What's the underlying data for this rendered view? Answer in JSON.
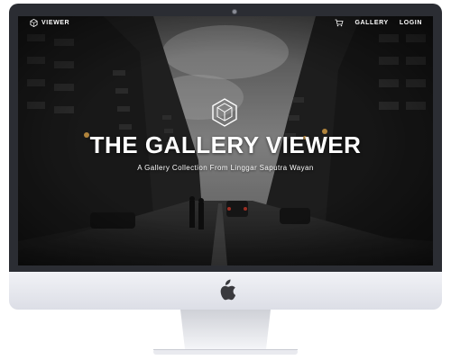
{
  "nav": {
    "brand": "VIEWER",
    "gallery_label": "GALLERY",
    "login_label": "LOGIN"
  },
  "hero": {
    "title": "THE GALLERY VIEWER",
    "subtitle": "A Gallery Collection From Linggar Saputra Wayan"
  },
  "colors": {
    "frame": "#2b2d33",
    "chin": "#e4e6ec",
    "text": "#ffffff"
  },
  "icons": {
    "brand": "hexagon-cube-icon",
    "cart": "cart-icon",
    "hero": "hexagon-cube-icon",
    "hardware": "apple-icon"
  }
}
